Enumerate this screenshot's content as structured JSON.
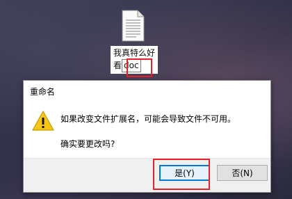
{
  "desktop": {
    "file_icon": "text-file-icon",
    "label_line1": "我真特么好",
    "label_name_part": "看",
    "label_ext_editing": "doc"
  },
  "dialog": {
    "title": "重命名",
    "warning_icon": "warning-triangle-icon",
    "message_line1": "如果改变文件扩展名，可能会导致文件不可用。",
    "message_line2": "确实要更改吗?",
    "yes_label": "是(Y)",
    "no_label": "否(N)"
  },
  "colors": {
    "highlight": "#e8202a",
    "focus_button_border": "#0078d7",
    "warning_yellow": "#f5c518"
  }
}
